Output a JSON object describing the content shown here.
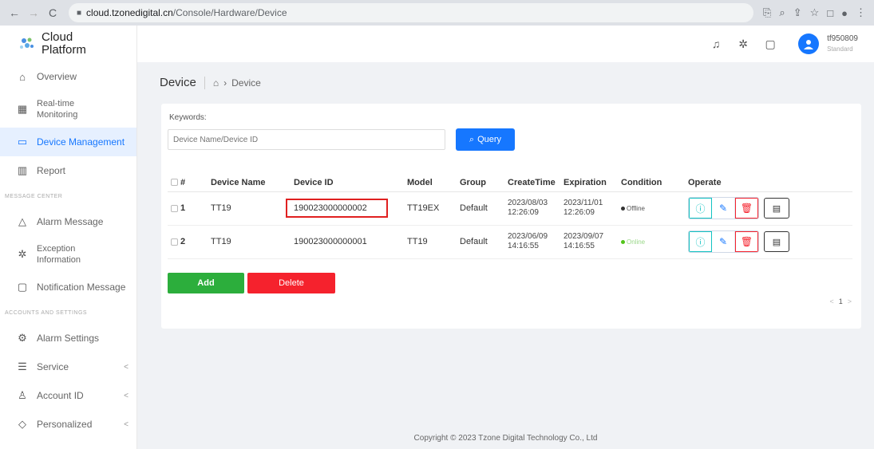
{
  "browser": {
    "url_host": "cloud.tzonedigital.cn",
    "url_path": "/Console/Hardware/Device"
  },
  "logo": {
    "line1": "Cloud",
    "line2": "Platform"
  },
  "sidebar": {
    "items": [
      {
        "label": "Overview",
        "icon": "home-icon"
      },
      {
        "label": "Real-time Monitoring",
        "line1": "Real-time",
        "line2": "Monitoring",
        "icon": "grid-icon"
      },
      {
        "label": "Device Management",
        "icon": "device-icon",
        "active": true
      },
      {
        "label": "Report",
        "icon": "chart-icon"
      }
    ],
    "group_message": "MESSAGE CENTER",
    "message_items": [
      {
        "label": "Alarm Message",
        "icon": "bell-icon"
      },
      {
        "label": "Exception Information",
        "line1": "Exception",
        "line2": "Information",
        "icon": "bug-icon"
      },
      {
        "label": "Notification Message",
        "icon": "message-icon"
      }
    ],
    "group_accounts": "ACCOUNTS AND SETTINGS",
    "account_items": [
      {
        "label": "Alarm Settings",
        "icon": "alarm-settings-icon"
      },
      {
        "label": "Service",
        "icon": "service-icon",
        "expandable": true
      },
      {
        "label": "Account ID",
        "icon": "user-icon",
        "expandable": true
      },
      {
        "label": "Personalized",
        "icon": "diamond-icon",
        "expandable": true
      }
    ],
    "chevron": "<"
  },
  "topbar": {
    "username": "tf950809",
    "tier": "Standard"
  },
  "breadcrumb": {
    "title": "Device",
    "current": "Device"
  },
  "search": {
    "label": "Keywords:",
    "placeholder": "Device Name/Device ID",
    "query_label": "Query"
  },
  "table": {
    "headers": [
      "#",
      "Device Name",
      "Device ID",
      "Model",
      "Group",
      "CreateTime",
      "Expiration",
      "Condition",
      "Operate"
    ],
    "rows": [
      {
        "index": "1",
        "name": "TT19",
        "device_id": "190023000000002",
        "model": "TT19EX",
        "group": "Default",
        "create_date": "2023/08/03",
        "create_time": "12:26:09",
        "exp_date": "2023/11/01",
        "exp_time": "12:26:09",
        "condition": "Offline"
      },
      {
        "index": "2",
        "name": "TT19",
        "device_id": "190023000000001",
        "model": "TT19",
        "group": "Default",
        "create_date": "2023/06/09",
        "create_time": "14:16:55",
        "exp_date": "2023/09/07",
        "exp_time": "14:16:55",
        "condition": "Online"
      }
    ]
  },
  "actions": {
    "add": "Add",
    "delete": "Delete"
  },
  "pager": {
    "prev": "<",
    "page": "1",
    "next": ">"
  },
  "footer": "Copyright © 2023 Tzone Digital Technology Co., Ltd",
  "colors": {
    "primary": "#1677ff",
    "add": "#2cae3c",
    "danger": "#f5222d",
    "info": "#13c2c2"
  }
}
